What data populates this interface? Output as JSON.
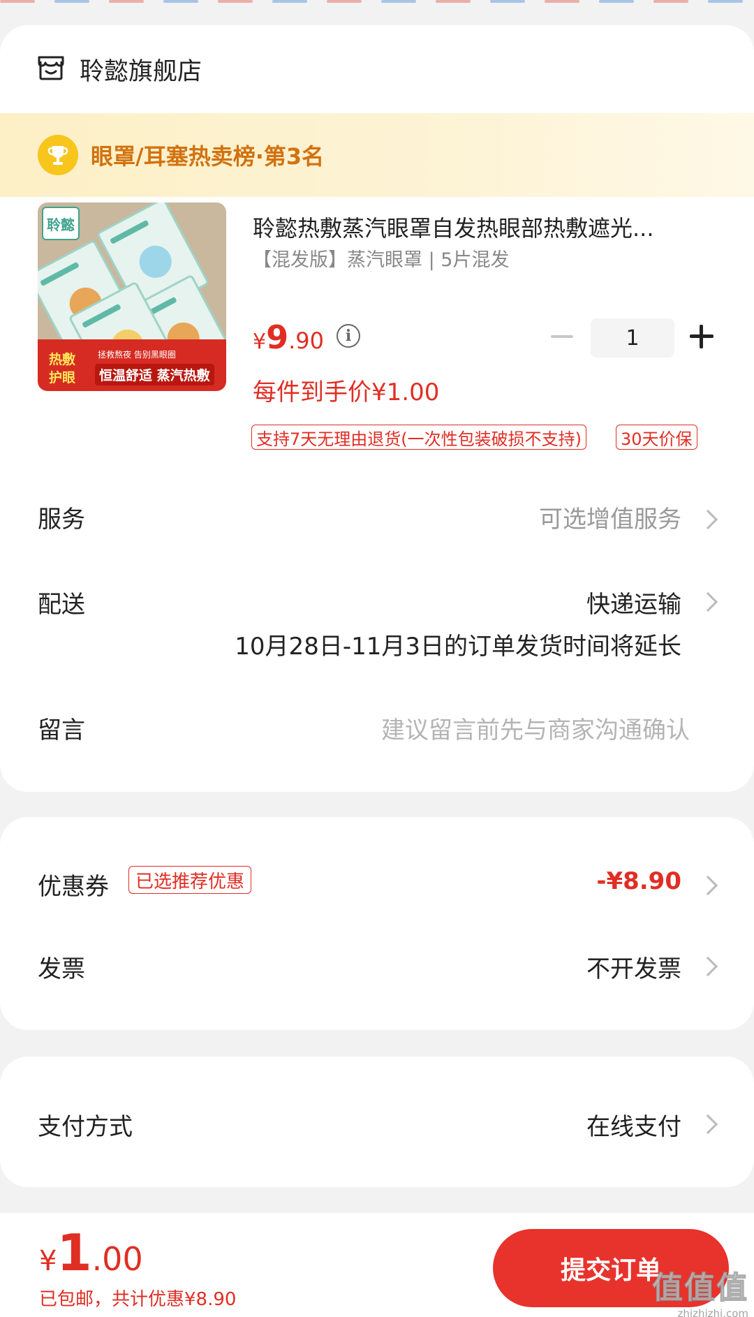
{
  "shop": {
    "name": "聆懿旗舰店",
    "icon": "shop-icon"
  },
  "rank_banner": {
    "text": "眼罩/耳塞热卖榜·第3名",
    "icon": "trophy-icon",
    "color": "#d27210"
  },
  "product": {
    "title": "聆懿热敷蒸汽眼罩自发热眼部热敷遮光...",
    "spec": "【混发版】蒸汽眼罩 | 5片混发",
    "price": {
      "symbol": "¥",
      "integer": "9",
      "decimal": ".90"
    },
    "unit_price": "每件到手价¥1.00",
    "quantity": "1",
    "tags": [
      "支持7天无理由退货(一次性包装破损不支持)",
      "30天价保"
    ],
    "image": {
      "logo": "聆懿",
      "band_left": "热敷\n护眼",
      "band_small": "拯救熬夜 告别黑眼圈",
      "band_big": "恒温舒适 蒸汽热敷"
    }
  },
  "rows": {
    "service": {
      "label": "服务",
      "value": "可选增值服务"
    },
    "delivery": {
      "label": "配送",
      "value": "快递运输",
      "note": "10月28日-11月3日的订单发货时间将延长"
    },
    "message": {
      "label": "留言",
      "placeholder": "建议留言前先与商家沟通确认"
    },
    "coupon": {
      "label": "优惠券",
      "badge": "已选推荐优惠",
      "value": "-¥8.90"
    },
    "invoice": {
      "label": "发票",
      "value": "不开发票"
    },
    "payment": {
      "label": "支付方式",
      "value": "在线支付"
    }
  },
  "footer": {
    "total": {
      "symbol": "¥",
      "integer": "1",
      "decimal": ".00"
    },
    "note": "已包邮，共计优惠¥8.90",
    "submit_label": "提交订单",
    "watermark": {
      "big": "值值值",
      "small": "zhizhizhi.com"
    }
  },
  "colors": {
    "accent": "#e02e24",
    "submit": "#e8322c",
    "rank_bg": "#fdf0c6",
    "trophy": "#f7c51c"
  }
}
